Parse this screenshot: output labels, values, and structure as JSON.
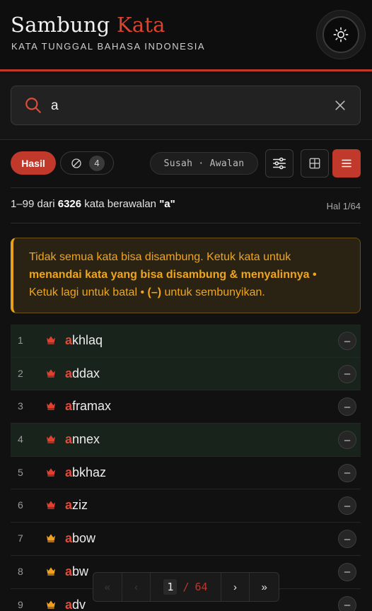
{
  "header": {
    "brand_main": "Sambung",
    "brand_accent": "Kata",
    "tagline": "KATA TUNGGAL BAHASA INDONESIA",
    "theme_icon": "sun-icon"
  },
  "search": {
    "value": "a",
    "placeholder": "",
    "icon": "search-icon",
    "clear_icon": "close-icon"
  },
  "toolbar": {
    "results_label": "Hasil",
    "hidden_count": "4",
    "mode_label": "Susah · Awalan",
    "buttons": [
      "sliders-icon",
      "grid-icon",
      "list-icon"
    ]
  },
  "summary": {
    "range": "1–99",
    "from": "dari",
    "total": "6326",
    "suffix": "kata berawalan",
    "query": "\"a\"",
    "page": "Hal 1/64"
  },
  "notice": {
    "line1": "Tidak semua kata bisa disambung. Ketuk kata untuk",
    "bold1": "menandai kata yang bisa disambung & menyalinnya •",
    "line3a": "Ketuk lagi untuk batal •",
    "bold2": "(–)",
    "line3b": "untuk sembunyikan."
  },
  "words": [
    {
      "num": "1",
      "prefix": "a",
      "rest": "khlaq",
      "rank": "red",
      "highlight": true
    },
    {
      "num": "2",
      "prefix": "a",
      "rest": "ddax",
      "rank": "red",
      "highlight": true
    },
    {
      "num": "3",
      "prefix": "a",
      "rest": "framax",
      "rank": "red",
      "highlight": false
    },
    {
      "num": "4",
      "prefix": "a",
      "rest": "nnex",
      "rank": "red",
      "highlight": true
    },
    {
      "num": "5",
      "prefix": "a",
      "rest": "bkhaz",
      "rank": "red",
      "highlight": false
    },
    {
      "num": "6",
      "prefix": "a",
      "rest": "ziz",
      "rank": "red",
      "highlight": false
    },
    {
      "num": "7",
      "prefix": "a",
      "rest": "bow",
      "rank": "gold",
      "highlight": false
    },
    {
      "num": "8",
      "prefix": "a",
      "rest": "bw",
      "rank": "gold",
      "highlight": false
    },
    {
      "num": "9",
      "prefix": "a",
      "rest": "dv",
      "rank": "gold",
      "highlight": false
    }
  ],
  "row_hide_label": "–",
  "pager": {
    "first": "«",
    "prev": "‹",
    "current": "1",
    "separator": "/",
    "total": "64",
    "next": "›",
    "last": "»"
  },
  "colors": {
    "accent": "#c0392b",
    "notice": "#f0a51c",
    "crown_red": "#e0402f",
    "crown_gold": "#f0a020"
  }
}
